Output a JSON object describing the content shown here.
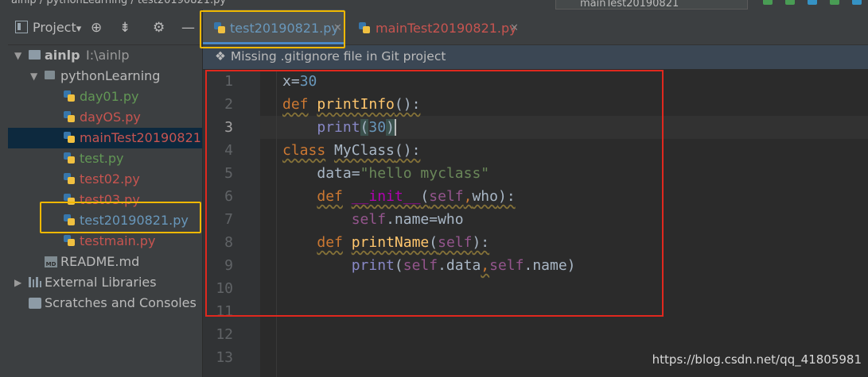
{
  "topbar": {
    "breadcrumb": "ainlp  /  pythonLearning  /  test20190821.py",
    "run_config": "mainTest20190821"
  },
  "project_panel": {
    "title": "Project",
    "title_arrow": "▾",
    "toolbar_icons": [
      "target-icon",
      "collapse-icon",
      "gear-icon",
      "minimize-icon"
    ]
  },
  "tree": [
    {
      "label": "ainlp",
      "path": "I:\\ainlp",
      "type": "folder",
      "depth": 0,
      "expanded": true,
      "color": "default"
    },
    {
      "label": "pythonLearning",
      "type": "folder",
      "depth": 1,
      "expanded": true,
      "color": "default"
    },
    {
      "label": "day01.py",
      "type": "py",
      "depth": 2,
      "color": "green"
    },
    {
      "label": "dayOS.py",
      "type": "py",
      "depth": 2,
      "color": "red"
    },
    {
      "label": "mainTest20190821.py",
      "type": "py",
      "depth": 2,
      "color": "red",
      "selected": true
    },
    {
      "label": "test.py",
      "type": "py",
      "depth": 2,
      "color": "green"
    },
    {
      "label": "test02.py",
      "type": "py",
      "depth": 2,
      "color": "red"
    },
    {
      "label": "test03.py",
      "type": "py",
      "depth": 2,
      "color": "red"
    },
    {
      "label": "test20190821.py",
      "type": "py",
      "depth": 2,
      "color": "blue"
    },
    {
      "label": "testmain.py",
      "type": "py",
      "depth": 2,
      "color": "red"
    },
    {
      "label": "README.md",
      "type": "md",
      "depth": 1,
      "color": "default"
    },
    {
      "label": "External Libraries",
      "type": "lib",
      "depth": 0,
      "expanded": false,
      "color": "default"
    },
    {
      "label": "Scratches and Consoles",
      "type": "scratch",
      "depth": 0,
      "color": "default"
    }
  ],
  "tabs": [
    {
      "label": "test20190821.py",
      "active": true
    },
    {
      "label": "mainTest20190821.py",
      "active": false
    }
  ],
  "notification": {
    "icon": "git-diamond-icon",
    "text": "Missing .gitignore file in Git project"
  },
  "editor": {
    "line_numbers": [
      "1",
      "2",
      "3",
      "4",
      "5",
      "6",
      "7",
      "8",
      "9",
      "10",
      "11",
      "12",
      "13"
    ],
    "current_line": 3,
    "code": {
      "l1_x": "x",
      "l1_eq": "=",
      "l1_num": "30",
      "l2_def": "def",
      "l2_fn": "printInfo",
      "l2_rest": "():",
      "l3_print": "print",
      "l3_open": "(",
      "l3_num": "30",
      "l3_close": ")",
      "l4_class": "class",
      "l4_name": "MyClass",
      "l4_rest": "():",
      "l5_data": "data",
      "l5_eq": "=",
      "l5_str": "\"hello myclass\"",
      "l6_def": "def",
      "l6_init": "__init__",
      "l6_open": "(",
      "l6_self": "self",
      "l6_comma": ",",
      "l6_who": "who",
      "l6_close": "):",
      "l7_self": "self",
      "l7_rest": ".name=who",
      "l8_def": "def",
      "l8_fn": "printName",
      "l8_open": "(",
      "l8_self": "self",
      "l8_close": "):",
      "l9_print": "print",
      "l9_open": "(",
      "l9_self1": "self",
      "l9_data": ".data",
      "l9_comma": ",",
      "l9_self2": "self",
      "l9_name": ".name",
      "l9_close": ")"
    }
  },
  "watermark": "https://blog.csdn.net/qq_41805981",
  "colors": {
    "highlight_red": "#e0281e",
    "highlight_orange": "#f0b800",
    "keyword": "#cc7832",
    "function": "#ffc66d",
    "number": "#6897bb",
    "string": "#6a8759",
    "self": "#94558d"
  }
}
